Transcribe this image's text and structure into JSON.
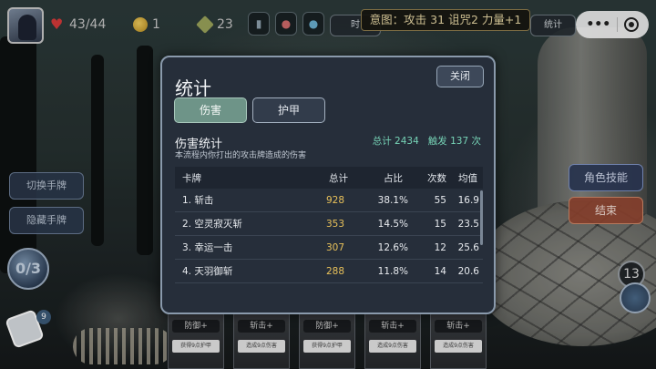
{
  "topbar": {
    "hp": "43/44",
    "gold": "1",
    "gems": "23",
    "intent": "意图：攻击 31 诅咒2 力量+1",
    "stats_btn": "统计",
    "partial_btn": "时"
  },
  "side": {
    "switch_hand": "切换手牌",
    "hide_hand": "隐藏手牌",
    "energy": "0/3",
    "deck_count": "9"
  },
  "right": {
    "role_skill": "角色技能",
    "end_turn": "结束",
    "draw_pile": "13"
  },
  "hand": [
    {
      "name": "防御+",
      "desc": "获得9点护甲"
    },
    {
      "name": "斩击+",
      "desc": "造成9点伤害"
    },
    {
      "name": "防御+",
      "desc": "获得9点护甲"
    },
    {
      "name": "斩击+",
      "desc": "造成9点伤害"
    },
    {
      "name": "斩击+",
      "desc": "造成9点伤害"
    }
  ],
  "modal": {
    "title": "统计",
    "close": "关闭",
    "tabs": [
      "伤害",
      "护甲"
    ],
    "active_tab": 0,
    "section_title": "伤害统计",
    "section_desc": "本流程内你打出的攻击牌造成的伤害",
    "total": "总计 2434",
    "triggers": "触发 137 次",
    "columns": [
      "卡牌",
      "总计",
      "占比",
      "次数",
      "均值"
    ],
    "rows": [
      {
        "card": "1. 斩击",
        "total": "928",
        "pct": "38.1%",
        "count": "55",
        "avg": "16.9"
      },
      {
        "card": "2. 空灵寂灭斩",
        "total": "353",
        "pct": "14.5%",
        "count": "15",
        "avg": "23.5"
      },
      {
        "card": "3. 幸运一击",
        "total": "307",
        "pct": "12.6%",
        "count": "12",
        "avg": "25.6"
      },
      {
        "card": "4. 天羽御斩",
        "total": "288",
        "pct": "11.8%",
        "count": "14",
        "avg": "20.6"
      }
    ]
  }
}
